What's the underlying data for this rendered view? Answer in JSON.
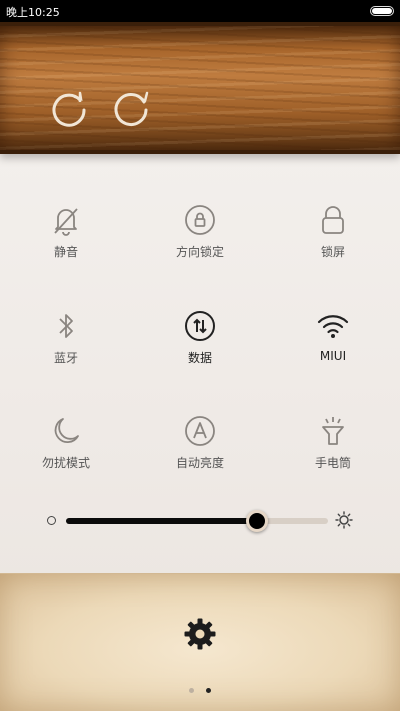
{
  "status_bar": {
    "time": "晚上10:25",
    "battery_level": 1.0
  },
  "wood_panel": {
    "buttons": [
      {
        "icon": "rotate-icon"
      },
      {
        "icon": "refresh-icon"
      }
    ]
  },
  "toggles": [
    {
      "label": "静音",
      "icon": "mute-bell-icon",
      "active": false
    },
    {
      "label": "方向锁定",
      "icon": "rotation-lock-icon",
      "active": false
    },
    {
      "label": "锁屏",
      "icon": "lock-icon",
      "active": false
    },
    {
      "label": "蓝牙",
      "icon": "bluetooth-icon",
      "active": false
    },
    {
      "label": "数据",
      "icon": "mobile-data-icon",
      "active": true
    },
    {
      "label": "MIUI",
      "icon": "wifi-icon",
      "active": true
    },
    {
      "label": "勿扰模式",
      "icon": "moon-icon",
      "active": false
    },
    {
      "label": "自动亮度",
      "icon": "auto-brightness-icon",
      "active": false
    },
    {
      "label": "手电筒",
      "icon": "flashlight-icon",
      "active": false
    }
  ],
  "brightness": {
    "level_percent": 73
  },
  "footer": {
    "settings_icon": "gear-icon",
    "pages": 2,
    "current_page": 2
  },
  "colors": {
    "inactive_icon": "#8a8580",
    "active_icon": "#222222",
    "wood": "#a7652b",
    "parchment": "#ecd9b8"
  }
}
